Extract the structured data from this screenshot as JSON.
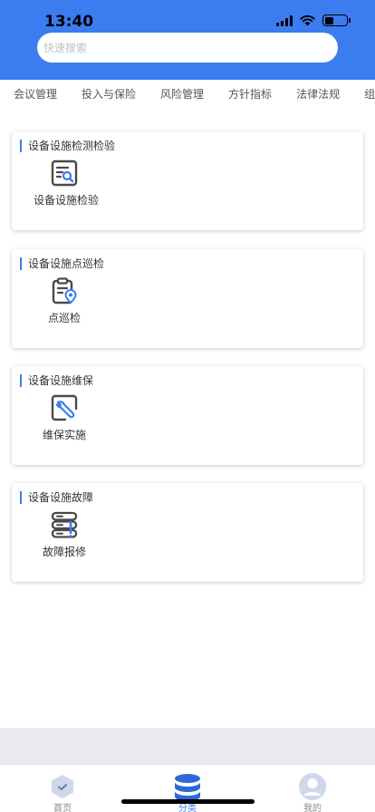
{
  "status_bar": {
    "time": "13:40"
  },
  "search": {
    "placeholder": "快速搜索"
  },
  "tabs": [
    {
      "label": "会议管理"
    },
    {
      "label": "投入与保险"
    },
    {
      "label": "风险管理"
    },
    {
      "label": "方针指标"
    },
    {
      "label": "法律法规"
    },
    {
      "label": "组织"
    }
  ],
  "cards": [
    {
      "title": "设备设施检测检验",
      "item_label": "设备设施检验",
      "icon": "inspection-doc-icon"
    },
    {
      "title": "设备设施点巡检",
      "item_label": "点巡检",
      "icon": "clipboard-location-icon"
    },
    {
      "title": "设备设施维保",
      "item_label": "维保实施",
      "icon": "wrench-icon"
    },
    {
      "title": "设备设施故障",
      "item_label": "故障报修",
      "icon": "server-alert-icon"
    }
  ],
  "bottom_nav": {
    "home_label": "首页",
    "category_label": "分类",
    "mine_label": "我的"
  },
  "colors": {
    "accent": "#3b7cf0",
    "header": "#3b7cf0",
    "icon": "#4a4a4a",
    "icon_accent": "#3b7cf0"
  }
}
